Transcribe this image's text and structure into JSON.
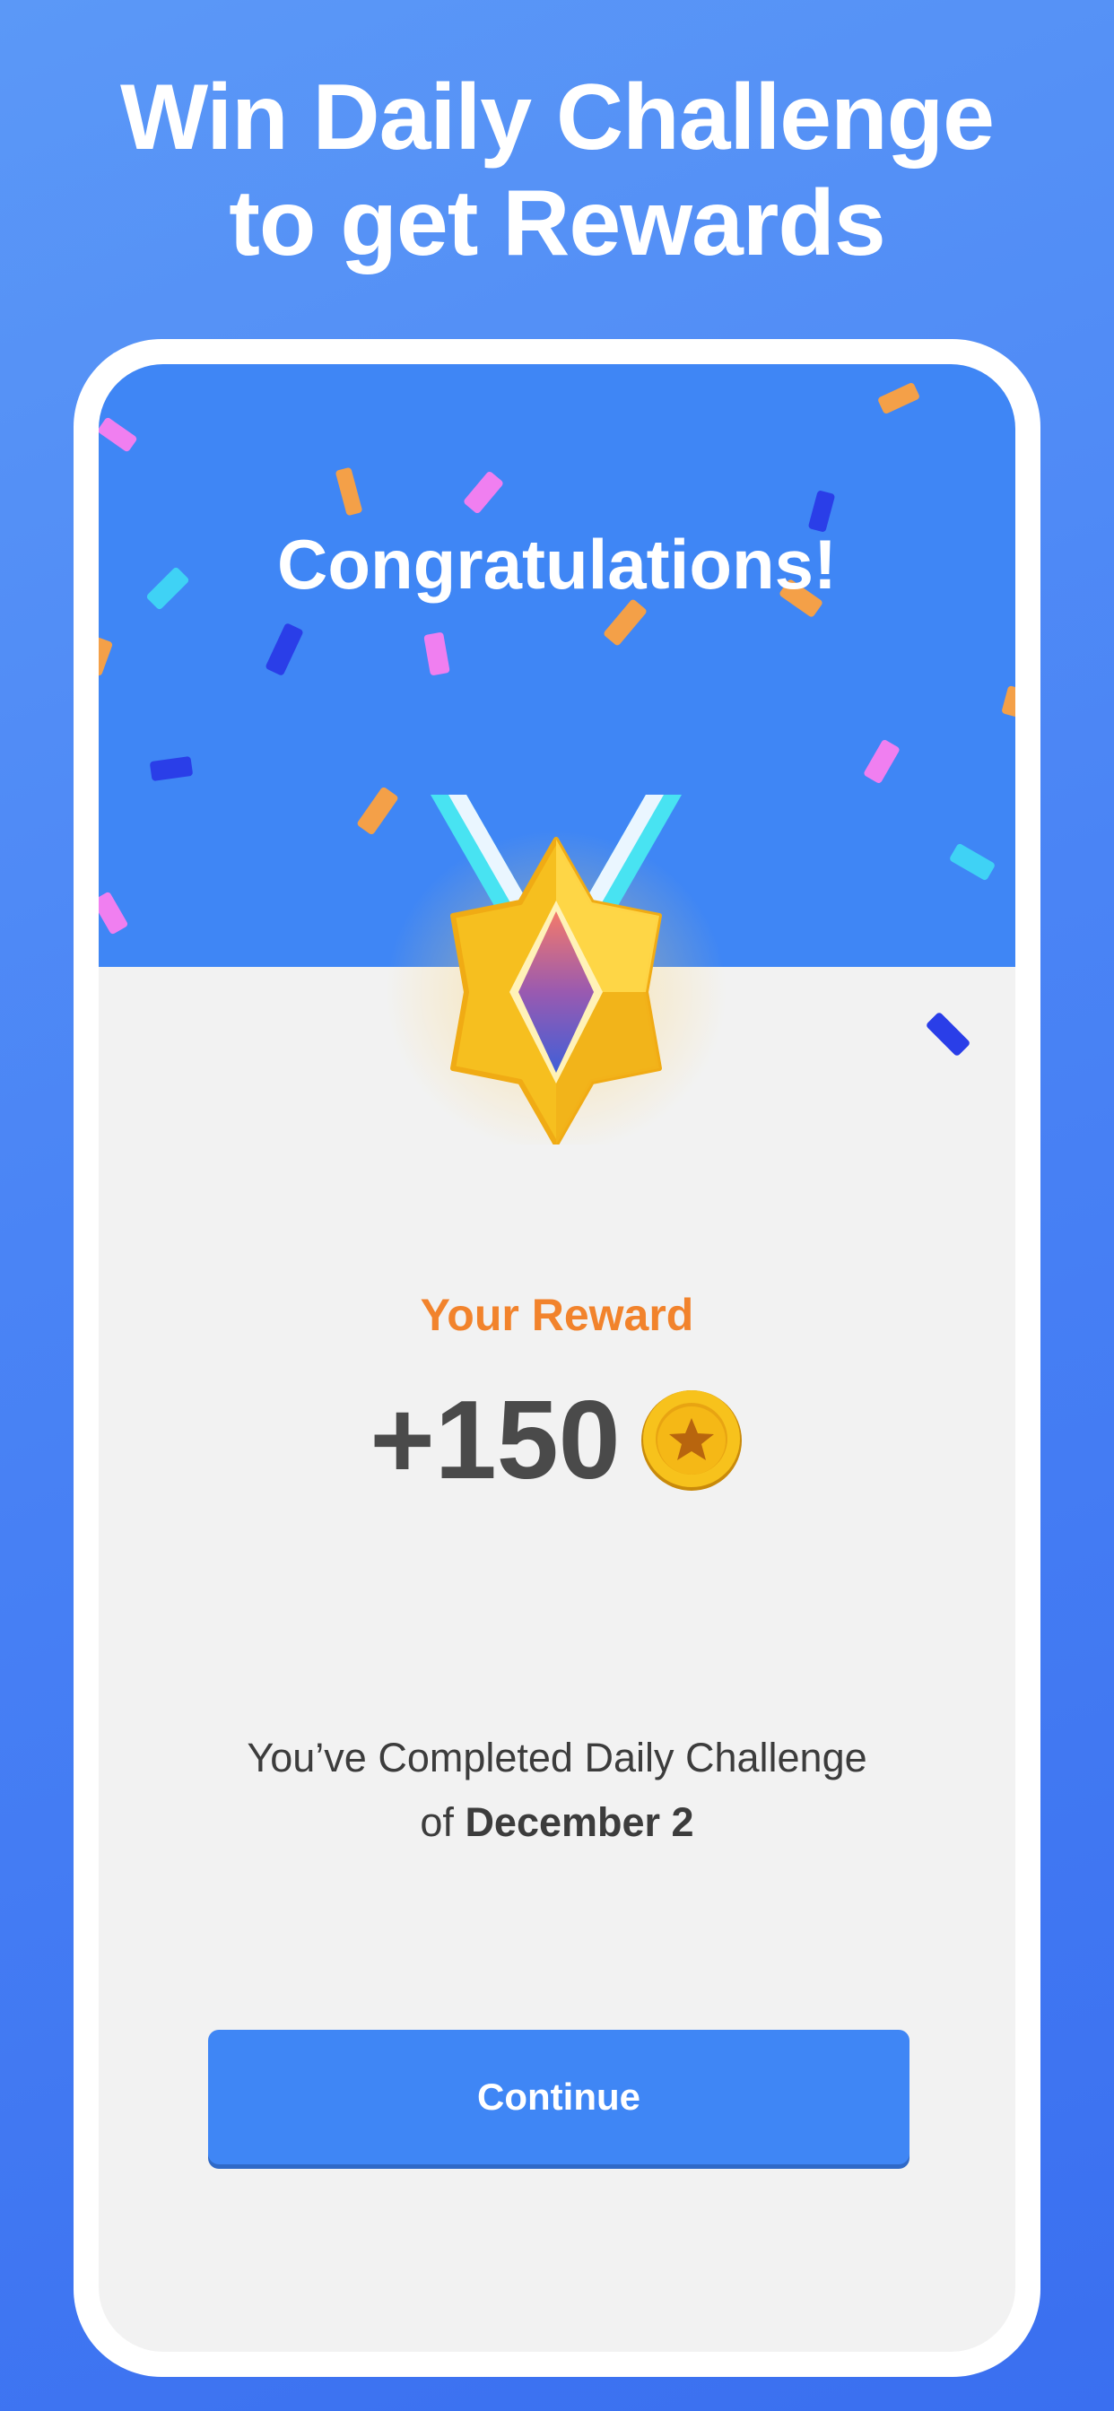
{
  "headline": {
    "line1": "Win Daily Challenge",
    "line2": "to get Rewards"
  },
  "screen": {
    "congrats": "Congratulations!",
    "reward_label": "Your Reward",
    "reward_amount": "+150",
    "reward_icon": "gold-coin-star-icon",
    "medal_icon": "gold-star-medal-icon",
    "message_line1": "You’ve Completed Daily Challenge",
    "message_prefix": "of",
    "message_date": "December 2",
    "continue_label": "Continue"
  },
  "colors": {
    "background": "#4a84f5",
    "hero": "#3f86f5",
    "card": "#f2f2f2",
    "reward_label": "#f2832c",
    "button": "#3f86f5"
  }
}
